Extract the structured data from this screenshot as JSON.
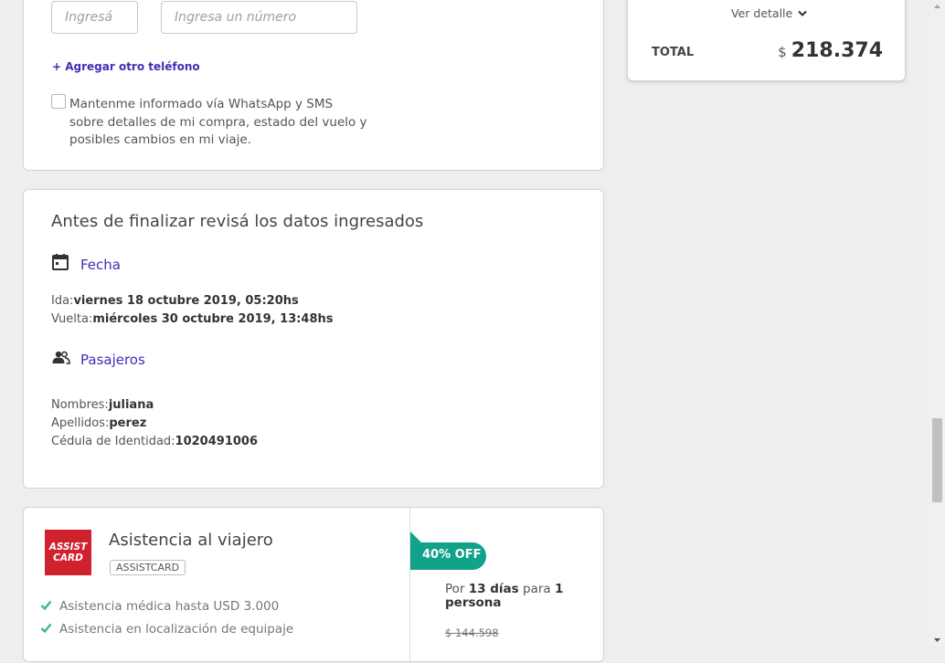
{
  "contact": {
    "area_placeholder": "Ingresá",
    "number_placeholder": "Ingresa un número",
    "add_phone": "+ Agregar otro teléfono",
    "whatsapp_line1": "Mantenme informado vía WhatsApp y SMS",
    "whatsapp_line2": "sobre detalles de mi compra, estado del vuelo y",
    "whatsapp_line3": "posibles cambios en mi viaje."
  },
  "summary": {
    "ver_detalle": "Ver detalle",
    "total_label": "TOTAL",
    "currency": "$",
    "total_value": "218.374"
  },
  "review": {
    "title": "Antes de finalizar revisá los datos ingresados",
    "fecha_heading": "Fecha",
    "ida_label": "Ida:",
    "ida_value": "viernes 18 octubre 2019, 05:20hs",
    "vuelta_label": "Vuelta:",
    "vuelta_value": "miércoles 30 octubre 2019, 13:48hs",
    "pasajeros_heading": "Pasajeros",
    "nombres_label": "Nombres:",
    "nombres_value": "juliana",
    "apellidos_label": "Apellidos:",
    "apellidos_value": "perez",
    "cedula_label": "Cédula de Identidad:",
    "cedula_value": "1020491006"
  },
  "assistance": {
    "logo_line1": "ASSIST",
    "logo_line2": "CARD",
    "title": "Asistencia al viajero",
    "provider_badge": "ASSISTCARD",
    "benefits": [
      "Asistencia médica hasta USD 3.000",
      "Asistencia en localización de equipaje"
    ],
    "discount": "40% OFF",
    "por": "Por",
    "dias": "13 días",
    "para": "para",
    "personas_num": "1",
    "persona": "persona",
    "old_price": "$ 144.598"
  },
  "colors": {
    "accent": "#3f2fb5",
    "discount": "#11a28a",
    "check": "#3fb39e",
    "logo_red": "#d0212e"
  }
}
